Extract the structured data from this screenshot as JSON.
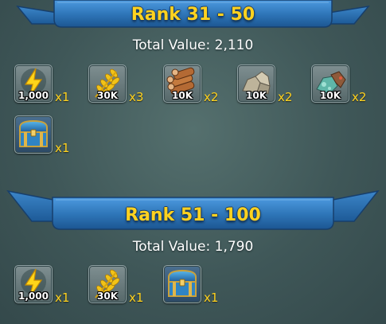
{
  "sections": [
    {
      "title": "Rank 31 - 50",
      "total_value": "Total Value: 2,110",
      "rewards": [
        {
          "icon": "energy-icon",
          "amount": "1,000",
          "qty": "x1"
        },
        {
          "icon": "grain-icon",
          "amount": "30K",
          "qty": "x3"
        },
        {
          "icon": "lumber-icon",
          "amount": "10K",
          "qty": "x2"
        },
        {
          "icon": "stone-icon",
          "amount": "10K",
          "qty": "x2"
        },
        {
          "icon": "ore-icon",
          "amount": "10K",
          "qty": "x2"
        },
        {
          "icon": "treasure-chest-icon",
          "amount": "",
          "qty": "x1"
        }
      ]
    },
    {
      "title": "Rank 51 - 100",
      "total_value": "Total Value: 1,790",
      "rewards": [
        {
          "icon": "energy-icon",
          "amount": "1,000",
          "qty": "x1"
        },
        {
          "icon": "grain-icon",
          "amount": "30K",
          "qty": "x1"
        },
        {
          "icon": "treasure-chest-icon",
          "amount": "",
          "qty": "x1"
        }
      ]
    }
  ],
  "colors": {
    "banner_blue": "#2f78b8",
    "title_gold": "#ffd21f",
    "qty_gold": "#ffd21f"
  }
}
